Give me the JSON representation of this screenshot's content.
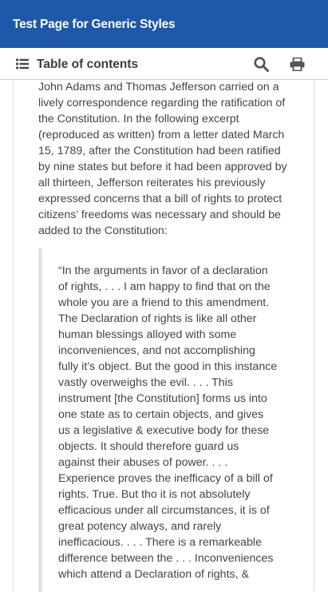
{
  "header": {
    "title": "Test Page for Generic Styles"
  },
  "toc": {
    "label": "Table of contents"
  },
  "icons": {
    "toc": "list-icon",
    "search": "search-icon",
    "print": "print-icon"
  },
  "colors": {
    "header_bg": "#1f58a8",
    "header_text": "#ffffff",
    "body_text": "#444444"
  },
  "content": {
    "intro": "John Adams and Thomas Jefferson carried on a lively correspondence regarding the ratification of the Constitution. In the following excerpt (reproduced as written) from a letter dated March 15, 1789, after the Constitution had been ratified by nine states but before it had been approved by all thirteen, Jefferson reiterates his previously expressed concerns that a bill of rights to protect citizens’ freedoms was necessary and should be added to the Constitution:",
    "quote": "“In the arguments in favor of a declaration of rights, . . . I am happy to find that on the whole you are a friend to this amendment. The Declaration of rights is like all other human blessings alloyed with some inconveniences, and not accomplishing fully it’s object. But the good in this instance vastly overweighs the evil. . . . This instrument [the Constitution] forms us into one state as to certain objects, and gives us a legislative & executive body for these objects. It should therefore guard us against their abuses of power. . . . Experience proves the inefficacy of a bill of rights. True. But tho it is not absolutely efficacious under all circumstances, it is of great potency always, and rarely inefficacious. . . . There is a remarkeable difference between the . . . Inconveniences which attend a Declaration of rights, &"
  }
}
